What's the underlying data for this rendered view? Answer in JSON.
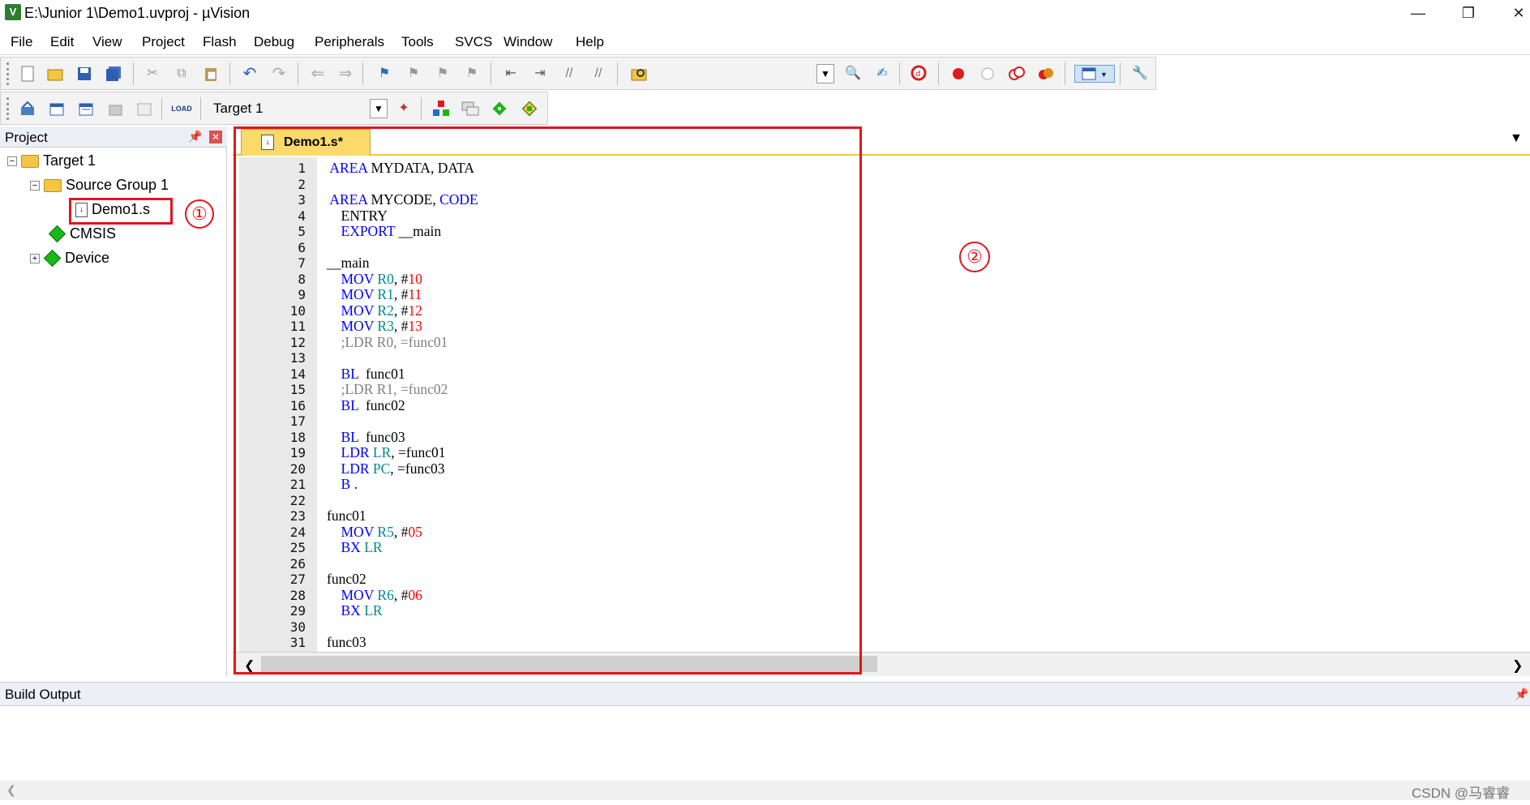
{
  "window": {
    "title": "E:\\Junior 1\\Demo1.uvproj - µVision",
    "app_icon": "V"
  },
  "menu": [
    "File",
    "Edit",
    "View",
    "Project",
    "Flash",
    "Debug",
    "Peripherals",
    "Tools",
    "SVCS",
    "Window",
    "Help"
  ],
  "toolbar2": {
    "target": "Target 1"
  },
  "project_panel": {
    "title": "Project",
    "tree": {
      "target": "Target 1",
      "group": "Source Group 1",
      "file": "Demo1.s",
      "cmsis": "CMSIS",
      "device": "Device"
    }
  },
  "annotations": {
    "mark1": "①",
    "mark2": "②"
  },
  "editor": {
    "tab": "Demo1.s*",
    "lines": [
      [
        {
          "t": " "
        },
        {
          "t": "AREA",
          "c": "kw"
        },
        {
          "t": " MYDATA, DATA"
        }
      ],
      [],
      [
        {
          "t": " "
        },
        {
          "t": "AREA",
          "c": "kw"
        },
        {
          "t": " MYCODE, "
        },
        {
          "t": "CODE",
          "c": "kw"
        }
      ],
      [
        {
          "t": "    ENTRY"
        }
      ],
      [
        {
          "t": "    "
        },
        {
          "t": "EXPORT",
          "c": "kw"
        },
        {
          "t": " __main"
        }
      ],
      [],
      [
        {
          "t": "__main"
        }
      ],
      [
        {
          "t": "    "
        },
        {
          "t": "MOV",
          "c": "kw"
        },
        {
          "t": " "
        },
        {
          "t": "R0",
          "c": "reg"
        },
        {
          "t": ", #"
        },
        {
          "t": "10",
          "c": "num"
        }
      ],
      [
        {
          "t": "    "
        },
        {
          "t": "MOV",
          "c": "kw"
        },
        {
          "t": " "
        },
        {
          "t": "R1",
          "c": "reg"
        },
        {
          "t": ", #"
        },
        {
          "t": "11",
          "c": "num"
        }
      ],
      [
        {
          "t": "    "
        },
        {
          "t": "MOV",
          "c": "kw"
        },
        {
          "t": " "
        },
        {
          "t": "R2",
          "c": "reg"
        },
        {
          "t": ", #"
        },
        {
          "t": "12",
          "c": "num"
        }
      ],
      [
        {
          "t": "    "
        },
        {
          "t": "MOV",
          "c": "kw"
        },
        {
          "t": " "
        },
        {
          "t": "R3",
          "c": "reg"
        },
        {
          "t": ", #"
        },
        {
          "t": "13",
          "c": "num"
        }
      ],
      [
        {
          "t": "    "
        },
        {
          "t": ";LDR R0, =func01",
          "c": "cm"
        }
      ],
      [],
      [
        {
          "t": "    "
        },
        {
          "t": "BL",
          "c": "kw"
        },
        {
          "t": "  func01"
        }
      ],
      [
        {
          "t": "    "
        },
        {
          "t": ";LDR R1, =func02",
          "c": "cm"
        }
      ],
      [
        {
          "t": "    "
        },
        {
          "t": "BL",
          "c": "kw"
        },
        {
          "t": "  func02"
        }
      ],
      [],
      [
        {
          "t": "    "
        },
        {
          "t": "BL",
          "c": "kw"
        },
        {
          "t": "  func03"
        }
      ],
      [
        {
          "t": "    "
        },
        {
          "t": "LDR",
          "c": "kw"
        },
        {
          "t": " "
        },
        {
          "t": "LR",
          "c": "reg"
        },
        {
          "t": ", =func01"
        }
      ],
      [
        {
          "t": "    "
        },
        {
          "t": "LDR",
          "c": "kw"
        },
        {
          "t": " "
        },
        {
          "t": "PC",
          "c": "reg"
        },
        {
          "t": ", =func03"
        }
      ],
      [
        {
          "t": "    "
        },
        {
          "t": "B",
          "c": "kw"
        },
        {
          "t": " ."
        }
      ],
      [],
      [
        {
          "t": "func01"
        }
      ],
      [
        {
          "t": "    "
        },
        {
          "t": "MOV",
          "c": "kw"
        },
        {
          "t": " "
        },
        {
          "t": "R5",
          "c": "reg"
        },
        {
          "t": ", #"
        },
        {
          "t": "05",
          "c": "num"
        }
      ],
      [
        {
          "t": "    "
        },
        {
          "t": "BX",
          "c": "kw"
        },
        {
          "t": " "
        },
        {
          "t": "LR",
          "c": "reg"
        }
      ],
      [],
      [
        {
          "t": "func02"
        }
      ],
      [
        {
          "t": "    "
        },
        {
          "t": "MOV",
          "c": "kw"
        },
        {
          "t": " "
        },
        {
          "t": "R6",
          "c": "reg"
        },
        {
          "t": ", #"
        },
        {
          "t": "06",
          "c": "num"
        }
      ],
      [
        {
          "t": "    "
        },
        {
          "t": "BX",
          "c": "kw"
        },
        {
          "t": " "
        },
        {
          "t": "LR",
          "c": "reg"
        }
      ],
      [],
      [
        {
          "t": "func03"
        }
      ]
    ]
  },
  "build_output": {
    "title": "Build Output"
  },
  "watermark": "CSDN @马睿睿"
}
